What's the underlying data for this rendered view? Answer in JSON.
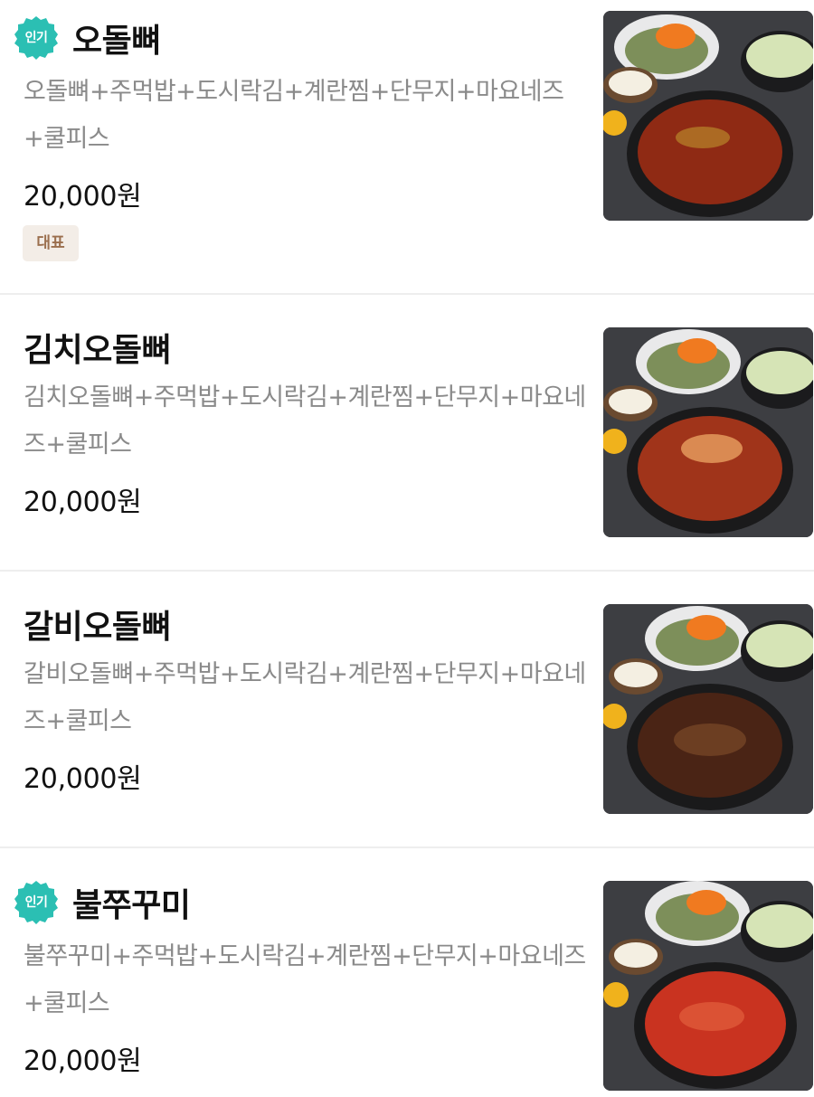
{
  "menu_items": [
    {
      "name": "오돌뼈",
      "popular_badge": "인기",
      "description": "오돌뼈+주먹밥+도시락김+계란찜+단무지+마요네즈+쿨피스",
      "price": "20,000원",
      "tag": "대표",
      "dish_color": "#8f2a14"
    },
    {
      "name": "김치오돌뼈",
      "description": "김치오돌뼈+주먹밥+도시락김+계란찜+단무지+마요네즈+쿨피스",
      "price": "20,000원",
      "dish_color": "#a0341a"
    },
    {
      "name": "갈비오돌뼈",
      "description": "갈비오돌뼈+주먹밥+도시락김+계란찜+단무지+마요네즈+쿨피스",
      "price": "20,000원",
      "dish_color": "#4a2415"
    },
    {
      "name": "불쭈꾸미",
      "popular_badge": "인기",
      "description": "불쭈꾸미+주먹밥+도시락김+계란찜+단무지+마요네즈+쿨피스",
      "price": "20,000원",
      "dish_color": "#c93320"
    }
  ],
  "colors": {
    "badge_teal": "#2bbfb3",
    "tag_bg": "#f3ede7",
    "tag_text": "#9b6f4e",
    "description_gray": "#8a8a8a"
  }
}
